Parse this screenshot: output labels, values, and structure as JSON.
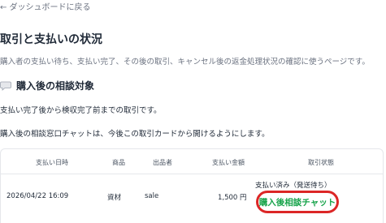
{
  "nav": {
    "back_label": "← ダッシュボードに戻る"
  },
  "header": {
    "title": "取引と支払いの状況",
    "description": "購入者の支払い待ち、支払い完了、その後の取引、キャンセル後の返金処理状況の確認に使うページです。"
  },
  "section": {
    "icon": "chat-bubble-icon",
    "heading": "購入後の相談対象",
    "line1": "支払い完了後から検収完了前までの取引です。",
    "line2": "購入後の相談窓口チャットは、今後この取引カードから開けるようにします。"
  },
  "table": {
    "headers": [
      "支払い日時",
      "商品",
      "出品者",
      "支払い金額",
      "取引状態"
    ],
    "rows": [
      {
        "date": "2026/04/22 16:09",
        "product": "資材",
        "seller": "sale",
        "amount": "1,500 円",
        "status": "支払い済み（発送待ち）",
        "action_label": "購入後相談チャット"
      }
    ]
  },
  "colors": {
    "accent_green": "#16a34a",
    "highlight_red": "#dc2626",
    "muted": "#6b7280"
  }
}
